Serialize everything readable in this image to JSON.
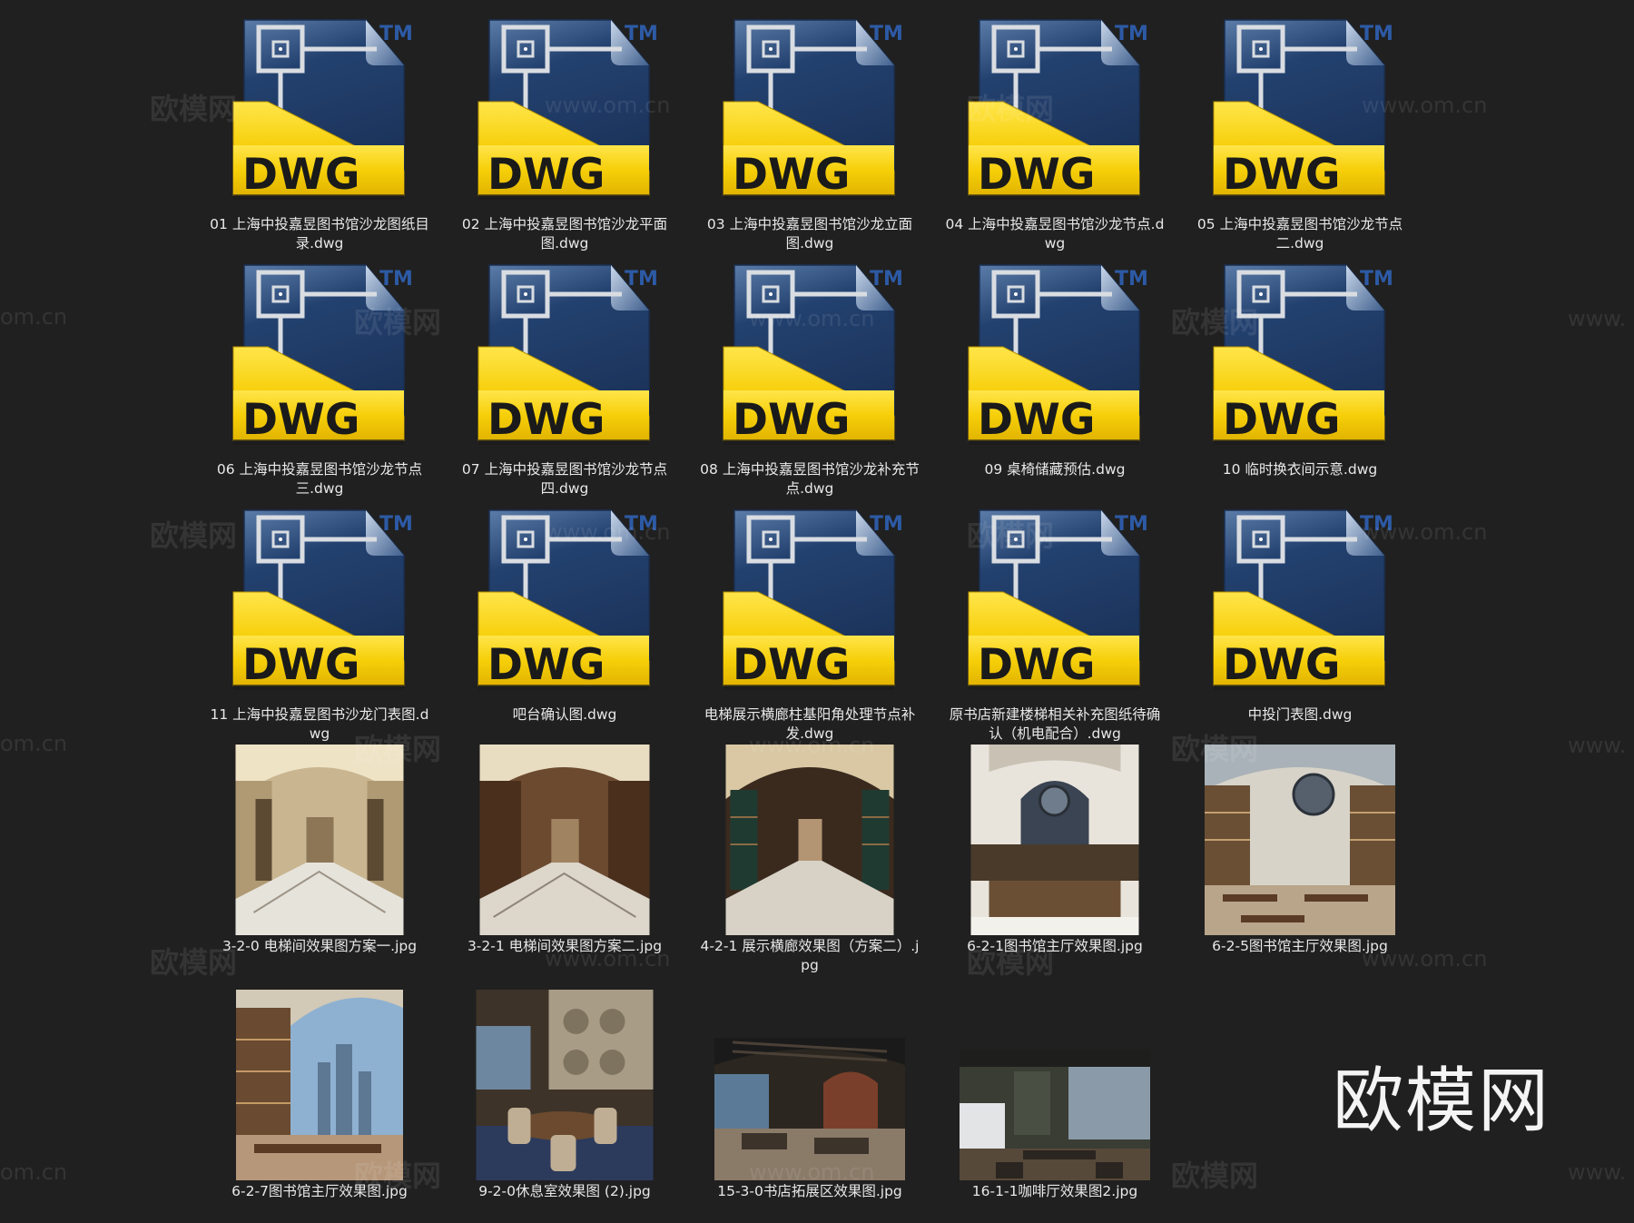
{
  "watermark": {
    "brand": "欧模网",
    "url": "www.om.cn",
    "url_partial_left": "om.cn",
    "url_partial_right": "www."
  },
  "dwg_icon": {
    "badge": "DWG",
    "tm": "TM",
    "colors": {
      "blue": "#23416f",
      "yellow": "#f6cf09",
      "frame": "#d9dde2"
    }
  },
  "files": [
    {
      "name": "01 上海中投嘉昱图书馆沙龙图纸目录.dwg",
      "type": "dwg"
    },
    {
      "name": "02 上海中投嘉昱图书馆沙龙平面图.dwg",
      "type": "dwg"
    },
    {
      "name": "03 上海中投嘉昱图书馆沙龙立面图.dwg",
      "type": "dwg"
    },
    {
      "name": "04 上海中投嘉昱图书馆沙龙节点.dwg",
      "type": "dwg"
    },
    {
      "name": "05 上海中投嘉昱图书馆沙龙节点二.dwg",
      "type": "dwg"
    },
    {
      "name": "06 上海中投嘉昱图书馆沙龙节点三.dwg",
      "type": "dwg"
    },
    {
      "name": "07 上海中投嘉昱图书馆沙龙节点四.dwg",
      "type": "dwg"
    },
    {
      "name": "08 上海中投嘉昱图书馆沙龙补充节点.dwg",
      "type": "dwg"
    },
    {
      "name": "09 桌椅储藏预估.dwg",
      "type": "dwg"
    },
    {
      "name": "10 临时换衣间示意.dwg",
      "type": "dwg"
    },
    {
      "name": "11 上海中投嘉昱图书沙龙门表图.dwg",
      "type": "dwg"
    },
    {
      "name": "吧台确认图.dwg",
      "type": "dwg"
    },
    {
      "name": "电梯展示横廊柱基阳角处理节点补发.dwg",
      "type": "dwg"
    },
    {
      "name": "原书店新建楼梯相关补充图纸待确认（机电配合）.dwg",
      "type": "dwg"
    },
    {
      "name": "中投门表图.dwg",
      "type": "dwg"
    },
    {
      "name": "3-2-0 电梯间效果图方案一.jpg",
      "type": "jpg",
      "scene": "corridor-light"
    },
    {
      "name": "3-2-1 电梯间效果图方案二.jpg",
      "type": "jpg",
      "scene": "corridor-wood"
    },
    {
      "name": "4-2-1 展示横廊效果图（方案二）.jpg",
      "type": "jpg",
      "scene": "corridor-shelves"
    },
    {
      "name": "6-2-1图书馆主厅效果图.jpg",
      "type": "jpg",
      "scene": "hall-window"
    },
    {
      "name": "6-2-5图书馆主厅效果图.jpg",
      "type": "jpg",
      "scene": "hall-reading"
    },
    {
      "name": "6-2-7图书馆主厅效果图.jpg",
      "type": "jpg",
      "scene": "hall-glass"
    },
    {
      "name": "9-2-0休息室效果图 (2).jpg",
      "type": "jpg",
      "scene": "lounge"
    },
    {
      "name": "15-3-0书店拓展区效果图.jpg",
      "type": "jpg",
      "scene": "expansion"
    },
    {
      "name": "16-1-1咖啡厅效果图2.jpg",
      "type": "jpg",
      "scene": "cafe"
    }
  ]
}
